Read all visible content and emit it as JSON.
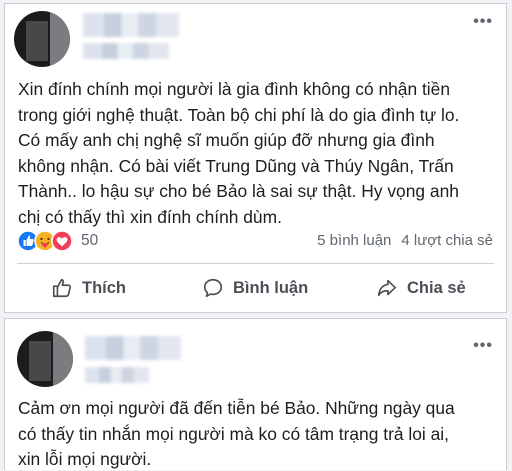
{
  "post1": {
    "more_label": "•••",
    "text": "Xin đính chính mọi người là gia đình  không có nhận tiền\ntrong giới nghệ thuật. Toàn bộ chi phí là do gia đình tự lo.\nCó mấy anh chị nghệ sĩ muốn giúp đỡ nhưng gia đình\nkhông nhận. Có bài viết Trung Dũng và Thúy Ngân, Trấn\nThành.. lo hậu sự cho bé Bảo là sai sự thật. Hy vọng anh\nchị có thấy thì xin đính chính dùm.",
    "reaction_count": "50",
    "comments": "5 bình luận",
    "shares": "4 lượt chia sẻ",
    "actions": {
      "like": "Thích",
      "comment": "Bình luận",
      "share": "Chia sẻ"
    }
  },
  "post2": {
    "more_label": "•••",
    "text": "Cảm ơn mọi người đã đến tiễn bé Bảo. Những ngày qua\ncó thấy tin nhắn mọi người mà ko có tâm trạng trả loi ai,\nxin lỗi mọi người."
  },
  "colors": {
    "like": "#1877f2",
    "care": "#f7b125",
    "love": "#f33e58",
    "secondary_text": "#606770"
  },
  "icons": [
    "like-reaction-icon",
    "care-reaction-icon",
    "love-reaction-icon",
    "thumbs-up-icon",
    "comment-bubble-icon",
    "share-arrow-icon"
  ]
}
